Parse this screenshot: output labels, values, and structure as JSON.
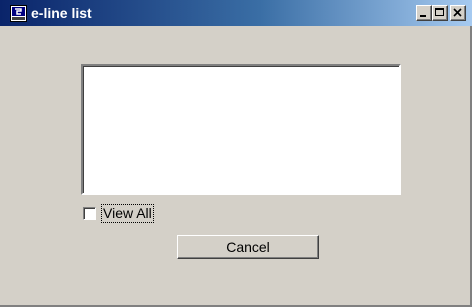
{
  "window": {
    "title": "e-line list",
    "icon": "app-icon",
    "caption_buttons": {
      "minimize": "minimize-icon",
      "maximize": "maximize-icon",
      "close": "close-icon"
    }
  },
  "list": {
    "items": []
  },
  "view_all": {
    "label": "View All",
    "checked": false
  },
  "cancel": {
    "label": "Cancel"
  },
  "colors": {
    "window_face": "#d4d0c8",
    "title_active_start": "#0a246a",
    "title_active_end": "#a6caf0",
    "title_text": "#ffffff",
    "list_background": "#ffffff"
  }
}
